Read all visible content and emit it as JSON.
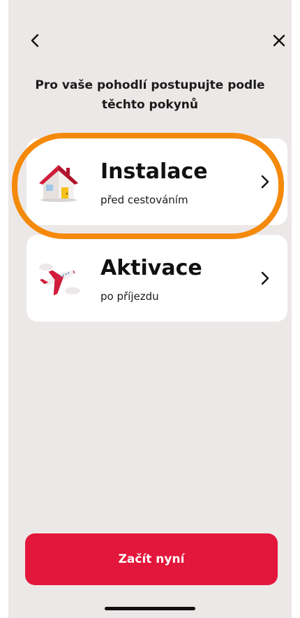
{
  "header": {
    "back_icon": "chevron-left-icon",
    "close_icon": "close-icon",
    "title": "Pro vaše pohodlí postupujte podle těchto pokynů"
  },
  "options": [
    {
      "title": "Instalace",
      "subtitle": "před cestováním",
      "icon": "house-icon",
      "highlighted": true
    },
    {
      "title": "Aktivace",
      "subtitle": "po příjezdu",
      "icon": "airplane-icon",
      "highlighted": false
    }
  ],
  "cta": {
    "label": "Začít nyní"
  },
  "colors": {
    "background": "#ece8e7",
    "card": "#ffffff",
    "accent": "#e3163b",
    "highlight": "#f5890a"
  }
}
